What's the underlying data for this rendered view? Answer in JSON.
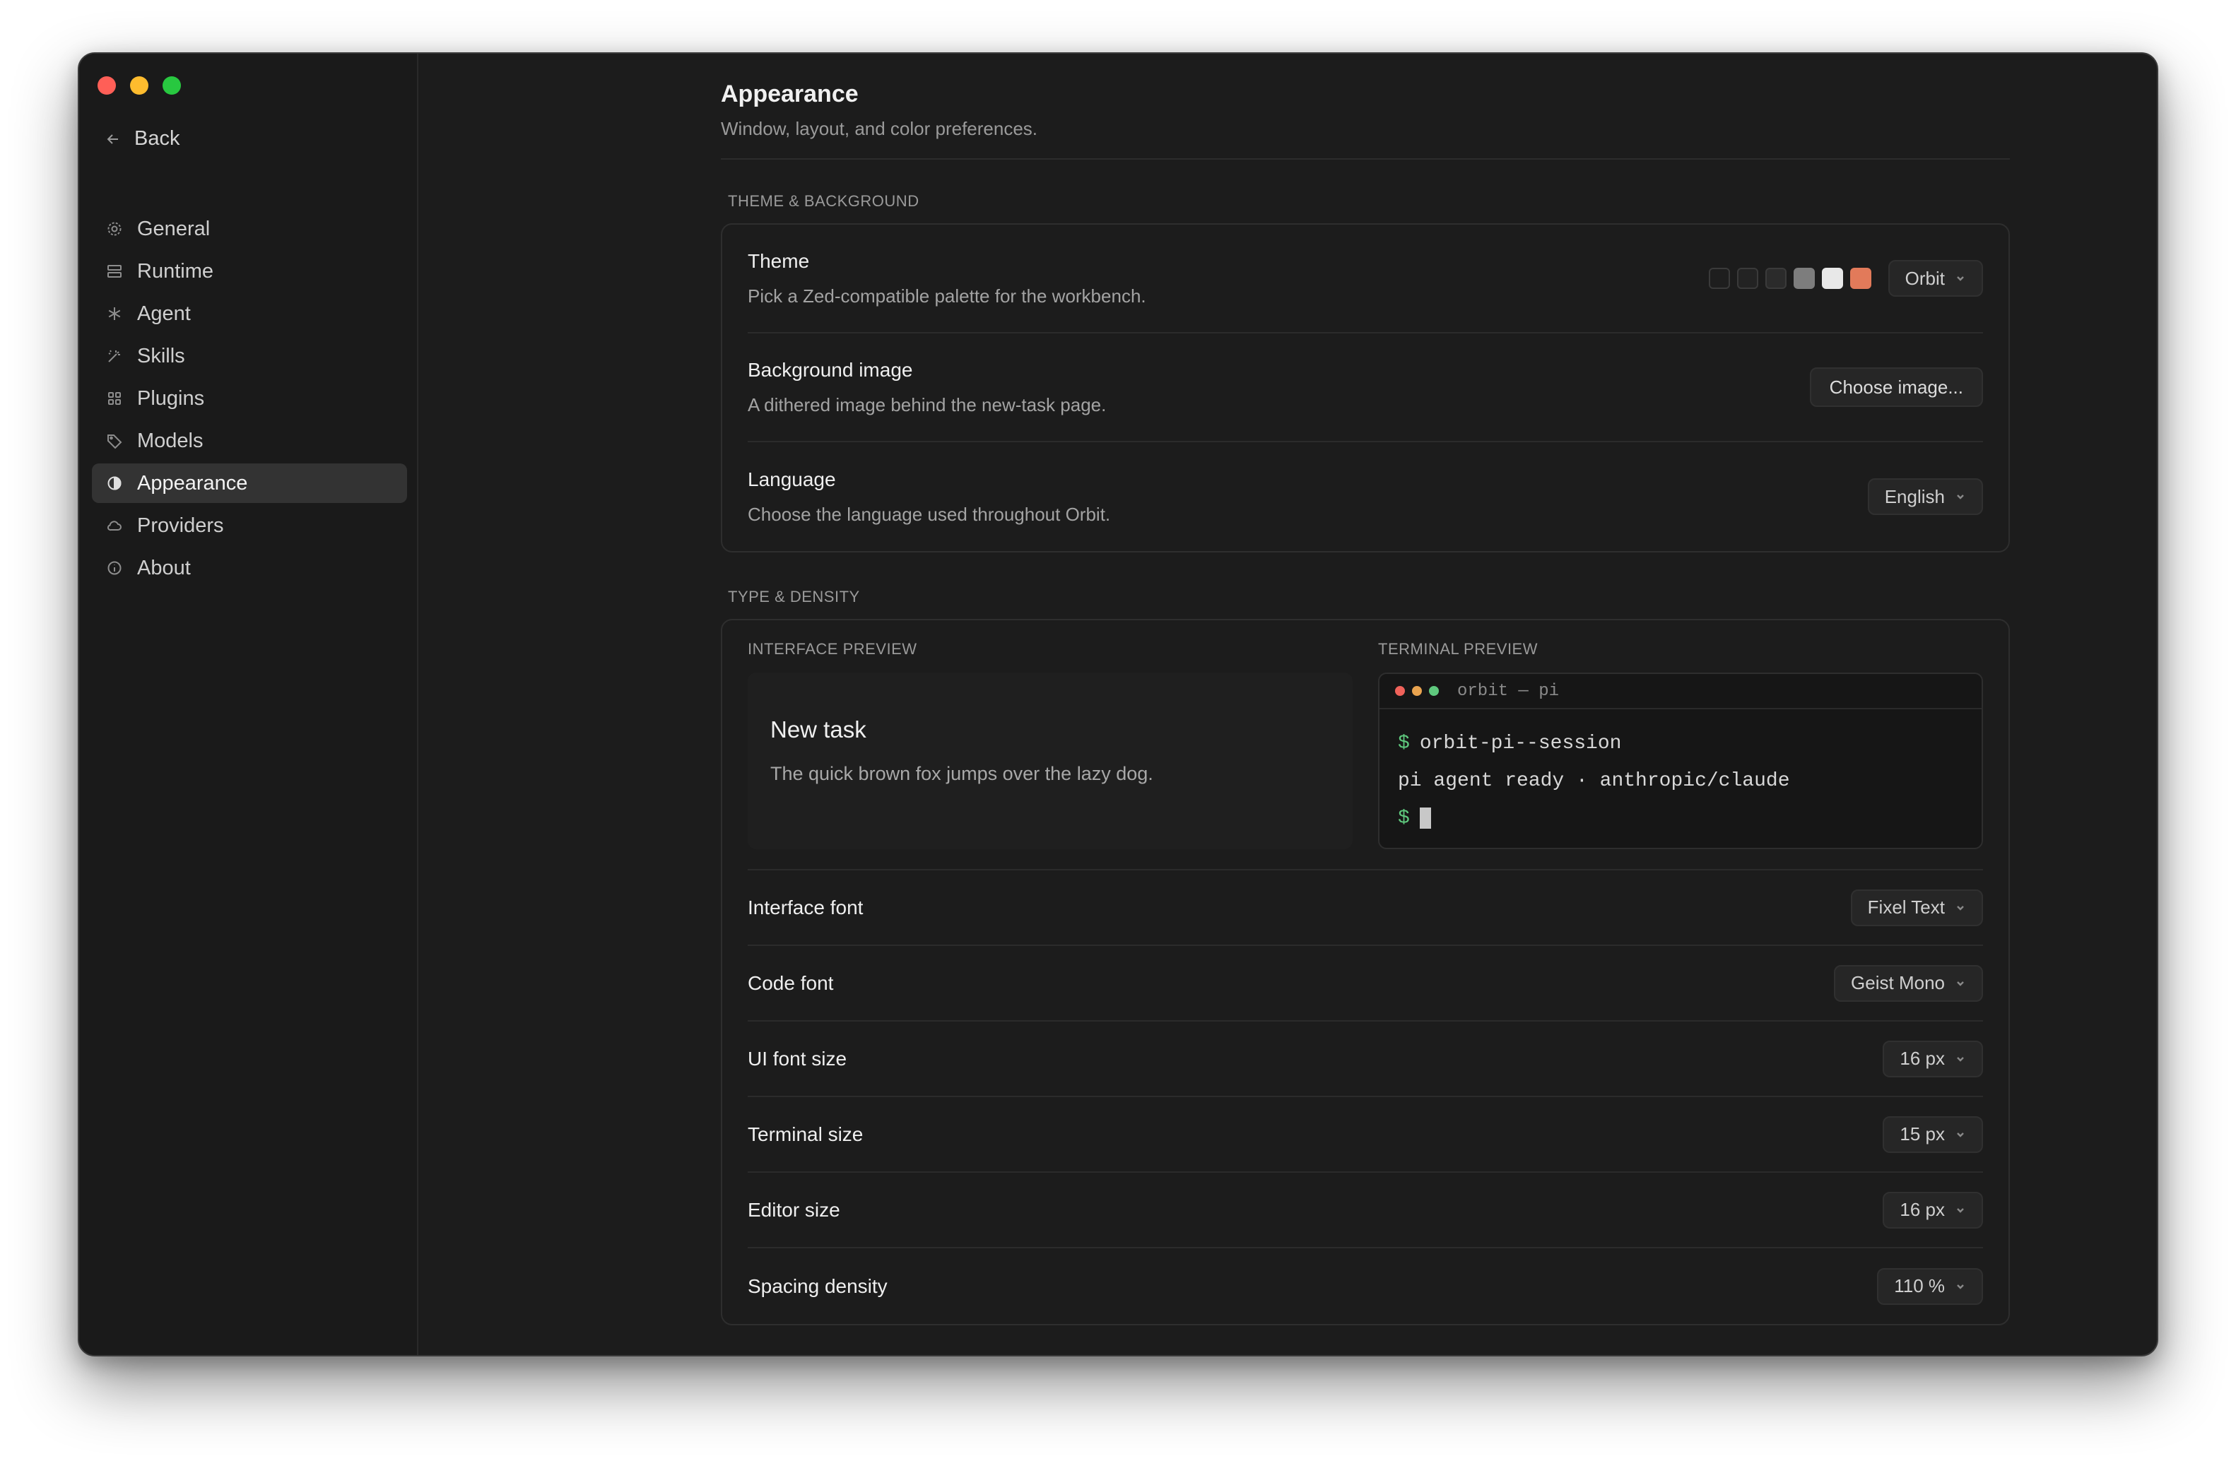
{
  "sidebar": {
    "back_label": "Back",
    "items": [
      {
        "label": "General",
        "icon": "gear-icon"
      },
      {
        "label": "Runtime",
        "icon": "server-icon"
      },
      {
        "label": "Agent",
        "icon": "asterisk-icon"
      },
      {
        "label": "Skills",
        "icon": "wand-icon"
      },
      {
        "label": "Plugins",
        "icon": "grid-icon"
      },
      {
        "label": "Models",
        "icon": "tag-icon"
      },
      {
        "label": "Appearance",
        "icon": "contrast-icon",
        "active": true
      },
      {
        "label": "Providers",
        "icon": "cloud-icon"
      },
      {
        "label": "About",
        "icon": "info-icon"
      }
    ]
  },
  "page": {
    "title": "Appearance",
    "subtitle": "Window, layout, and color preferences."
  },
  "theme_section": {
    "label": "THEME & BACKGROUND",
    "theme": {
      "title": "Theme",
      "desc": "Pick a Zed-compatible palette for the workbench.",
      "value": "Orbit",
      "swatches": [
        "#1e1e1e",
        "#232323",
        "#2b2b2b",
        "#7d7d7d",
        "#e8e8e8",
        "#e27a5a"
      ]
    },
    "background": {
      "title": "Background image",
      "desc": "A dithered image behind the new-task page.",
      "button": "Choose image..."
    },
    "language": {
      "title": "Language",
      "desc": "Choose the language used throughout Orbit.",
      "value": "English"
    }
  },
  "type_section": {
    "label": "TYPE & DENSITY",
    "interface_preview": {
      "label": "INTERFACE PREVIEW",
      "title": "New task",
      "body": "The quick brown fox jumps over the lazy dog."
    },
    "terminal_preview": {
      "label": "TERMINAL PREVIEW",
      "window_title": "orbit — pi",
      "prompt": "$",
      "line1": "orbit-pi--session",
      "line2": "pi agent ready · anthropic/claude"
    },
    "settings": [
      {
        "title": "Interface font",
        "value": "Fixel Text"
      },
      {
        "title": "Code font",
        "value": "Geist Mono"
      },
      {
        "title": "UI font size",
        "value": "16 px"
      },
      {
        "title": "Terminal size",
        "value": "15 px"
      },
      {
        "title": "Editor size",
        "value": "16 px"
      },
      {
        "title": "Spacing density",
        "value": "110 %"
      }
    ]
  },
  "colors": {
    "window_bg": "#1c1c1c",
    "prompt_green": "#5fc97e",
    "traffic": [
      "#ff5f57",
      "#febc2e",
      "#28c840"
    ],
    "term_dots": [
      "#f0625a",
      "#e9a34f",
      "#5fc97e"
    ]
  }
}
